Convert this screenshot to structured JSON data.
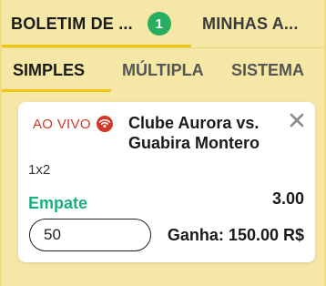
{
  "tabs": {
    "betslip_label": "BOLETIM DE ...",
    "betslip_count": "1",
    "mybets_label": "MINHAS A..."
  },
  "subtabs": {
    "single": "SIMPLES",
    "multiple": "MÚLTIPLA",
    "system": "SISTEMA"
  },
  "bet": {
    "live_label": "AO VIVO",
    "match": "Clube Aurora vs. Guabira Montero",
    "market": "1x2",
    "selection": "Empate",
    "odds": "3.00",
    "stake": "50",
    "gain_label": "Ganha: 150.00 R$"
  },
  "colors": {
    "panel_bg": "#f5e8a6",
    "accent": "#f1c40f",
    "badge": "#27ae60",
    "selection": "#1bb07a",
    "live": "#d0392a"
  },
  "icons": {
    "live": "live-broadcast-icon",
    "close": "close-icon"
  }
}
